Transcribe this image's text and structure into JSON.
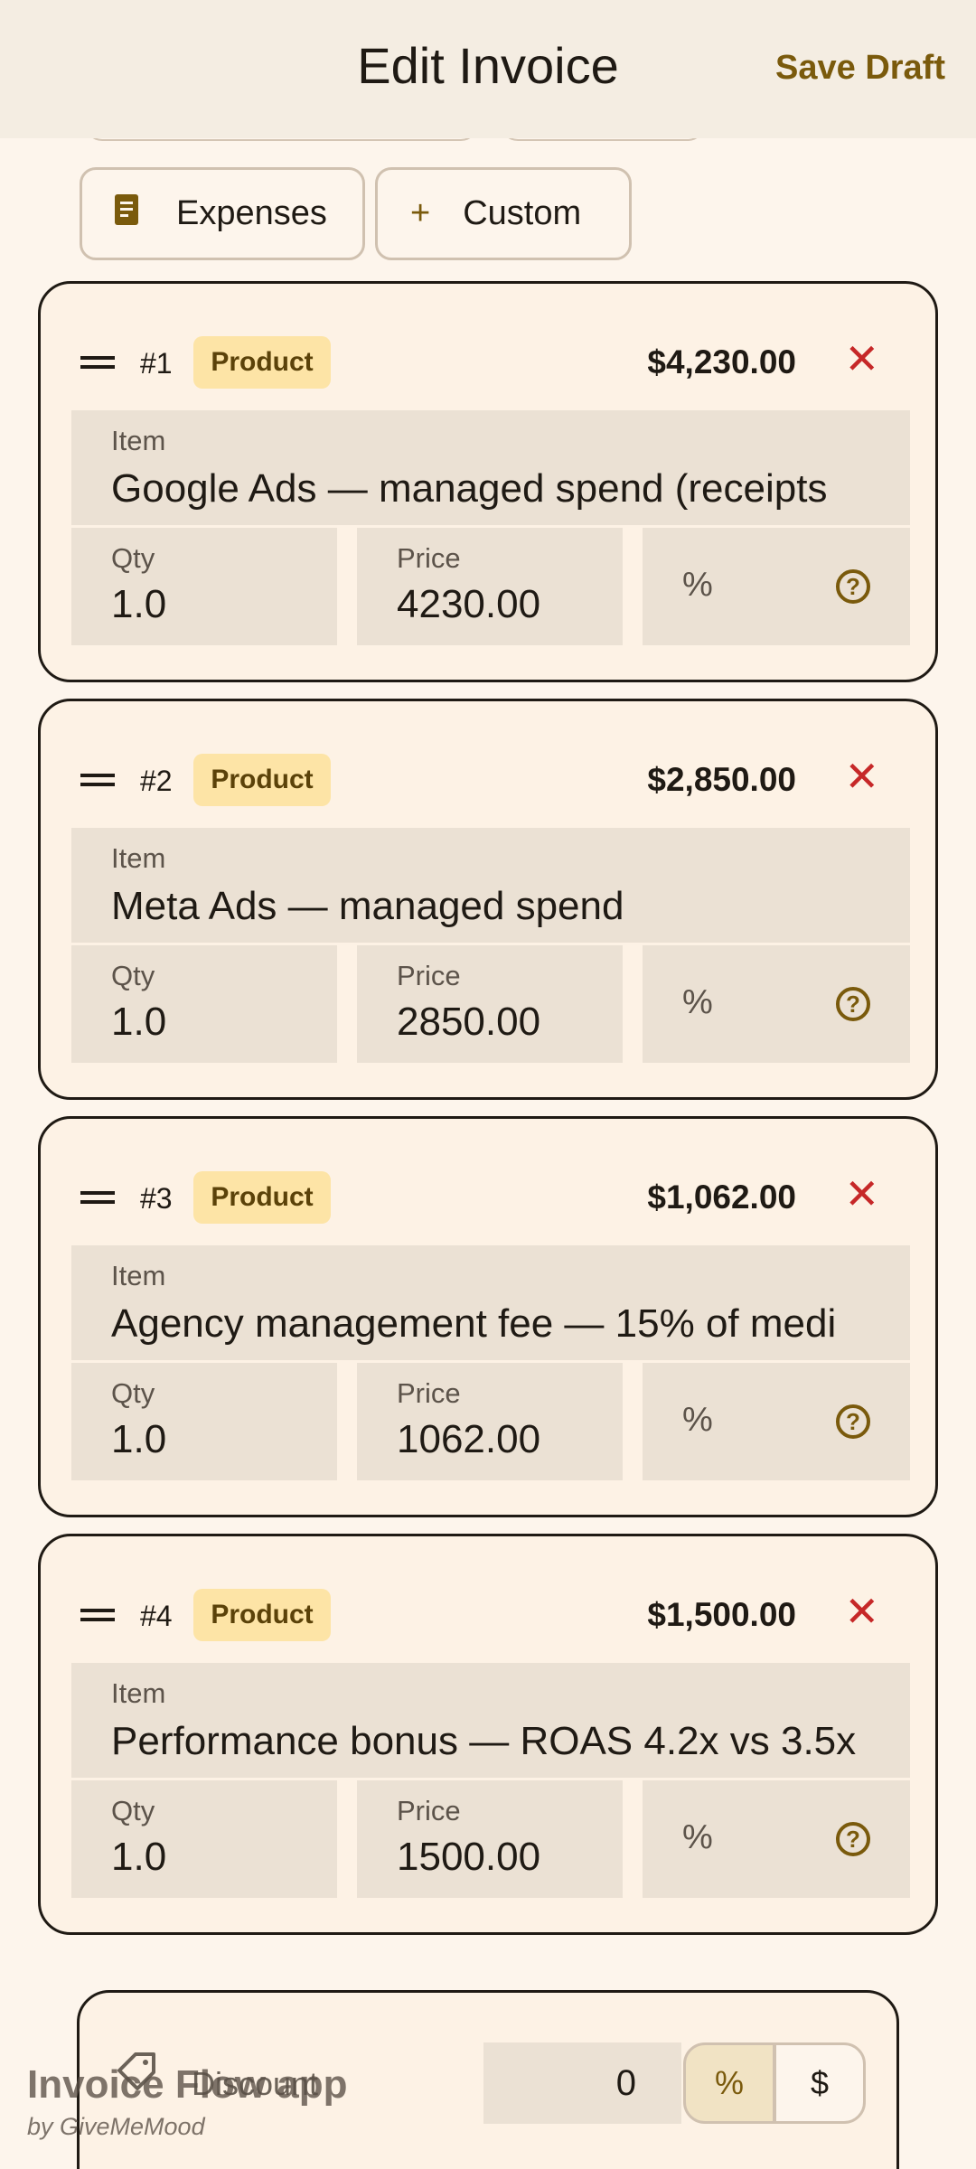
{
  "appbar": {
    "title": "Edit Invoice",
    "action": "Save Draft"
  },
  "chips": [
    {
      "label": "Expenses",
      "icon": "receipt-icon"
    },
    {
      "label": "Custom",
      "icon": "plus-icon"
    }
  ],
  "line_items": [
    {
      "index": "#1",
      "type": "Product",
      "total": "$4,230.00",
      "item_label": "Item",
      "item": "Google Ads — managed spend (receipts",
      "qty_label": "Qty",
      "qty": "1.0",
      "price_label": "Price",
      "price": "4230.00",
      "pct": "%"
    },
    {
      "index": "#2",
      "type": "Product",
      "total": "$2,850.00",
      "item_label": "Item",
      "item": "Meta Ads — managed spend",
      "qty_label": "Qty",
      "qty": "1.0",
      "price_label": "Price",
      "price": "2850.00",
      "pct": "%"
    },
    {
      "index": "#3",
      "type": "Product",
      "total": "$1,062.00",
      "item_label": "Item",
      "item": "Agency management fee — 15% of medi",
      "qty_label": "Qty",
      "qty": "1.0",
      "price_label": "Price",
      "price": "1062.00",
      "pct": "%"
    },
    {
      "index": "#4",
      "type": "Product",
      "total": "$1,500.00",
      "item_label": "Item",
      "item": "Performance bonus — ROAS 4.2x vs 3.5x",
      "qty_label": "Qty",
      "qty": "1.0",
      "price_label": "Price",
      "price": "1500.00",
      "pct": "%"
    }
  ],
  "discount": {
    "label": "Discount",
    "value": "0",
    "mode_percent": "%",
    "mode_dollar": "$",
    "selected": "percent"
  },
  "watermark": {
    "title": "Invoice Flow app",
    "subtitle": "by GiveMeMood"
  },
  "colors": {
    "accent": "#7a5a0c",
    "remove": "#c62828",
    "badge_bg": "#fde4a6",
    "background": "#fdf5ec"
  }
}
